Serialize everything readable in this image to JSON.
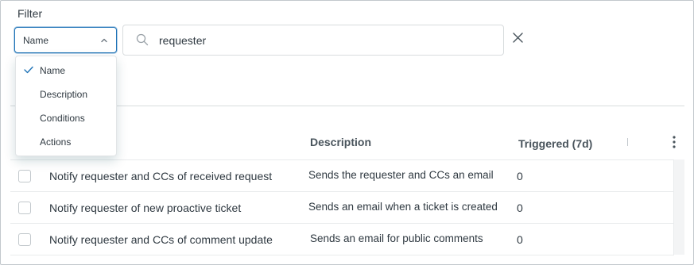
{
  "filter": {
    "label": "Filter",
    "select": {
      "value": "Name"
    },
    "search": {
      "value": "requester"
    },
    "options": [
      {
        "label": "Name",
        "selected": true
      },
      {
        "label": "Description",
        "selected": false
      },
      {
        "label": "Conditions",
        "selected": false
      },
      {
        "label": "Actions",
        "selected": false
      }
    ]
  },
  "table": {
    "headers": {
      "description": "Description",
      "triggered": "Triggered (7d)"
    },
    "rows": [
      {
        "name": "Notify requester and CCs of received request",
        "description": "Sends the requester and CCs an email",
        "triggered": "0"
      },
      {
        "name": "Notify requester of new proactive ticket",
        "description": "Sends an email when a ticket is created",
        "triggered": "0"
      },
      {
        "name": "Notify requester and CCs of comment update",
        "description": "Sends an email for public comments",
        "triggered": "0"
      }
    ]
  },
  "colors": {
    "accent": "#1f73b7",
    "border": "#d8dcde",
    "text": "#2f3941",
    "muted": "#68737d"
  },
  "icons": [
    "chevron-up-icon",
    "search-icon",
    "close-icon",
    "kebab-menu-icon",
    "check-icon"
  ]
}
